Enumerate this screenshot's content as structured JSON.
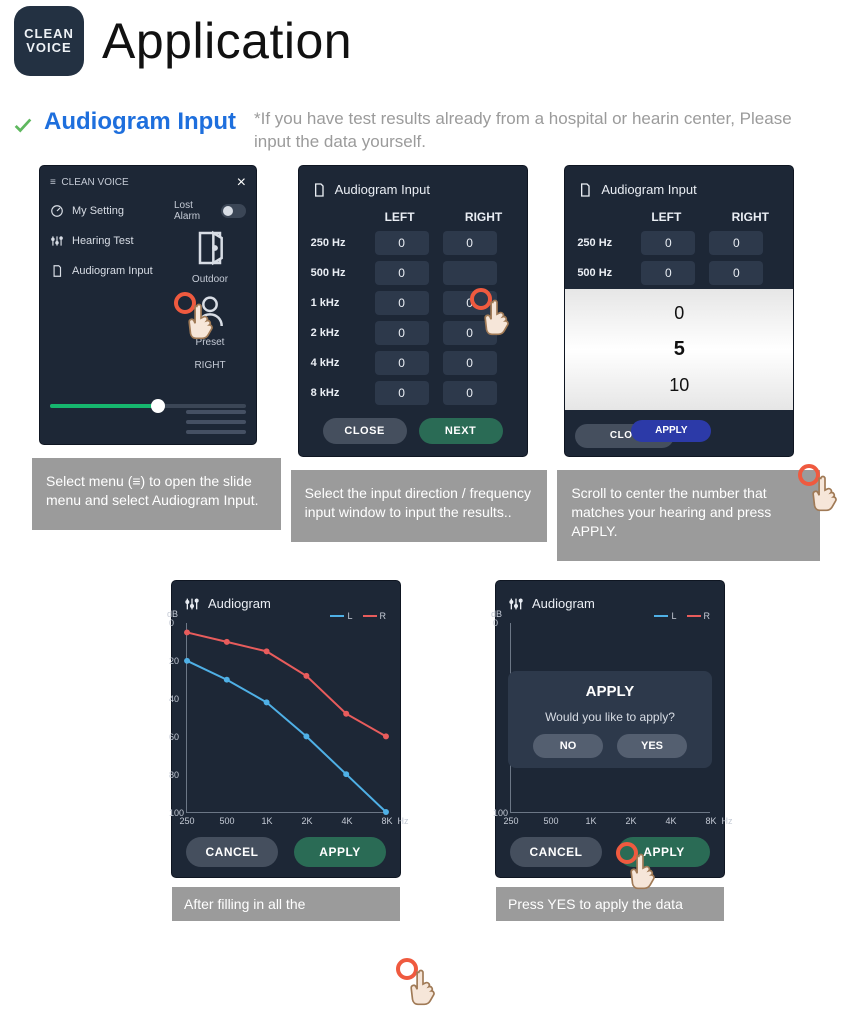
{
  "header": {
    "logo_line1": "CLEAN",
    "logo_line2": "VOICE",
    "title": "Application"
  },
  "section": {
    "title": "Audiogram Input",
    "note": "*If you have test results already from a hospital or hearin center, Please input the data yourself."
  },
  "phone1": {
    "brand": "CLEAN VOICE",
    "menu_items": [
      "My Setting",
      "Hearing Test",
      "Audiogram Input"
    ],
    "right_col": {
      "lost_alarm": "Lost Alarm",
      "outdoor": "Outdoor",
      "preset": "Preset",
      "right": "RIGHT"
    }
  },
  "phone2": {
    "title": "Audiogram Input",
    "col_L": "LEFT",
    "col_R": "RIGHT",
    "rows": [
      {
        "f": "250 Hz",
        "l": "0",
        "r": "0"
      },
      {
        "f": "500 Hz",
        "l": "0",
        "r": ""
      },
      {
        "f": "1 kHz",
        "l": "0",
        "r": "0"
      },
      {
        "f": "2 kHz",
        "l": "0",
        "r": "0"
      },
      {
        "f": "4 kHz",
        "l": "0",
        "r": "0"
      },
      {
        "f": "8 kHz",
        "l": "0",
        "r": "0"
      }
    ],
    "close": "CLOSE",
    "next": "NEXT"
  },
  "phone3": {
    "title": "Audiogram Input",
    "col_L": "LEFT",
    "col_R": "RIGHT",
    "rows": [
      {
        "f": "250 Hz",
        "l": "0",
        "r": "0"
      },
      {
        "f": "500 Hz",
        "l": "0",
        "r": "0"
      },
      {
        "f": "1 kHz",
        "l": "",
        "r": ""
      }
    ],
    "wheel": [
      "0",
      "5",
      "10"
    ],
    "close": "CLOS",
    "apply": "APPLY"
  },
  "chart_data": {
    "type": "line",
    "title": "Audiogram",
    "ylabel": "dB",
    "ylim": [
      0,
      100
    ],
    "yticks": [
      0,
      20,
      40,
      60,
      80,
      100
    ],
    "categories": [
      "250",
      "500",
      "1K",
      "2K",
      "4K",
      "8K"
    ],
    "xlabel": "Hz",
    "series": [
      {
        "name": "L",
        "color": "#4fb0e6",
        "values": [
          20,
          30,
          42,
          60,
          80,
          100
        ]
      },
      {
        "name": "R",
        "color": "#e85c5c",
        "values": [
          5,
          10,
          15,
          28,
          48,
          60
        ]
      }
    ]
  },
  "phone4": {
    "title": "Audiogram",
    "cancel": "CANCEL",
    "apply": "APPLY"
  },
  "phone5": {
    "title": "Audiogram",
    "yticks": [
      0,
      100
    ],
    "categories": [
      "250",
      "500",
      "1K",
      "2K",
      "4K",
      "8K"
    ],
    "dialog": {
      "title": "APPLY",
      "q": "Would you like to apply?",
      "no": "NO",
      "yes": "YES"
    },
    "cancel": "CANCEL",
    "apply": "APPLY"
  },
  "captions": {
    "c1": "Select menu (≡) to open the slide menu and select Audiogram Input.",
    "c2": "Select the input direction / frequency input window to input the results..",
    "c3": "Scroll to center the number that matches your hearing and press APPLY.",
    "c4": "After filling in all the",
    "c5": "Press YES to apply the data"
  }
}
